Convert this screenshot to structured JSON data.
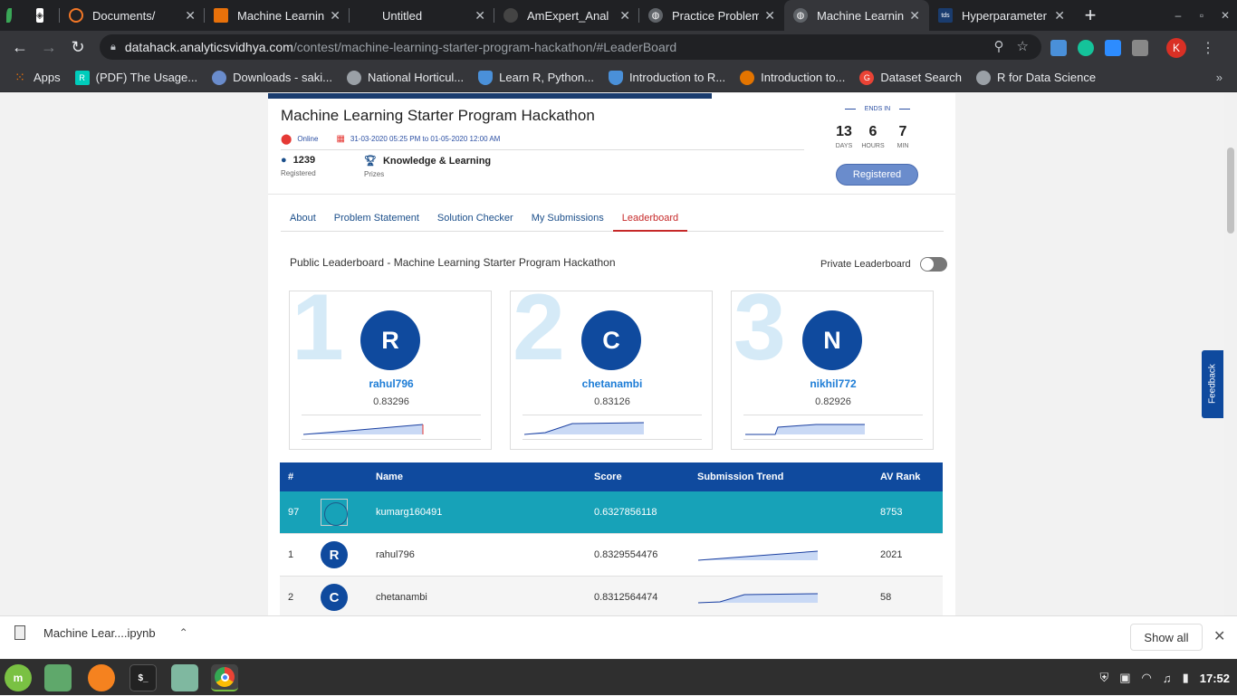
{
  "browser": {
    "tabs": [
      {
        "title": "",
        "icon": "mint-leaf-icon",
        "color": "#3aa757"
      },
      {
        "title": "",
        "icon": "grid-logo-icon",
        "color": "#888888"
      },
      {
        "title": "Documents/",
        "icon": "jupyter-icon",
        "color": "#f37726"
      },
      {
        "title": "Machine Learnin",
        "icon": "book-icon",
        "color": "#e8710a"
      },
      {
        "title": "Untitled",
        "icon": "blank-page-icon",
        "color": "#5f6368"
      },
      {
        "title": "AmExpert_Anal",
        "icon": "github-icon",
        "color": "#444444"
      },
      {
        "title": "Practice Problem",
        "icon": "globe-icon",
        "color": "#9aa0a6"
      },
      {
        "title": "Machine Learnin",
        "icon": "globe-icon",
        "color": "#9aa0a6"
      },
      {
        "title": "Hyperparameter",
        "icon": "tds-icon",
        "color": "#1a3c6e",
        "label": "tds"
      }
    ],
    "new_tab": "+",
    "url_host": "datahack.analyticsvidhya.com",
    "url_path": "/contest/machine-learning-starter-program-hackathon/#LeaderBoard",
    "profile_initial": "K",
    "bookmarks": [
      {
        "label": "Apps",
        "icon": "apps-grid-icon",
        "color": "#4285f4"
      },
      {
        "label": "(PDF) The Usage...",
        "icon": "researchgate-icon",
        "color": "#00ccbb",
        "badge": "R"
      },
      {
        "label": "Downloads - saki...",
        "icon": "globe-icon",
        "color": "#6a8ccc"
      },
      {
        "label": "National Horticul...",
        "icon": "globe-icon",
        "color": "#9aa0a6"
      },
      {
        "label": "Learn R, Python...",
        "icon": "shield-icon",
        "color": "#4a90d9"
      },
      {
        "label": "Introduction to R...",
        "icon": "shield-icon",
        "color": "#4a90d9"
      },
      {
        "label": "Introduction to...",
        "icon": "colab-icon",
        "color": "#e37400"
      },
      {
        "label": "Dataset Search",
        "icon": "google-icon",
        "color": "#ea4335"
      },
      {
        "label": "R for Data Science",
        "icon": "globe-icon",
        "color": "#9aa0a6"
      }
    ]
  },
  "contest": {
    "title": "Machine Learning Starter Program Hackathon",
    "location": "Online",
    "dates": "31-03-2020 05:25 PM to 01-05-2020 12:00 AM",
    "registered_count": "1239",
    "registered_label": "Registered",
    "prize_value": "Knowledge & Learning",
    "prize_label": "Prizes",
    "ends_in_label": "ENDS IN",
    "countdown": [
      {
        "value": "13",
        "unit": "DAYS"
      },
      {
        "value": "6",
        "unit": "HOURS"
      },
      {
        "value": "7",
        "unit": "MIN"
      }
    ],
    "register_button": "Registered",
    "tabs": [
      "About",
      "Problem Statement",
      "Solution Checker",
      "My Submissions",
      "Leaderboard"
    ],
    "active_tab": "Leaderboard"
  },
  "leaderboard": {
    "title": "Public Leaderboard - Machine Learning Starter Program Hackathon",
    "private_toggle_label": "Private Leaderboard",
    "podium": [
      {
        "rank": "1",
        "initial": "R",
        "name": "rahul796",
        "score": "0.83296"
      },
      {
        "rank": "2",
        "initial": "C",
        "name": "chetanambi",
        "score": "0.83126"
      },
      {
        "rank": "3",
        "initial": "N",
        "name": "nikhil772",
        "score": "0.82926"
      }
    ],
    "columns": [
      "#",
      "Name",
      "Score",
      "Submission Trend",
      "AV Rank"
    ],
    "rows": [
      {
        "rank": "97",
        "name": "kumarg160491",
        "score": "0.6327856118",
        "av_rank": "8753",
        "highlight": true
      },
      {
        "rank": "1",
        "initial": "R",
        "name": "rahul796",
        "score": "0.8329554476",
        "av_rank": "2021"
      },
      {
        "rank": "2",
        "initial": "C",
        "name": "chetanambi",
        "score": "0.8312564474",
        "av_rank": "58"
      }
    ],
    "feedback_label": "Feedback"
  },
  "downloads": {
    "file": "Machine Lear....ipynb",
    "show_all": "Show all"
  },
  "taskbar": {
    "clock": "17:52"
  },
  "colors": {
    "primary": "#0f4a9e",
    "highlight_row": "#17a2b8",
    "active_tab": "#c62828",
    "link": "#1e7dd6"
  }
}
